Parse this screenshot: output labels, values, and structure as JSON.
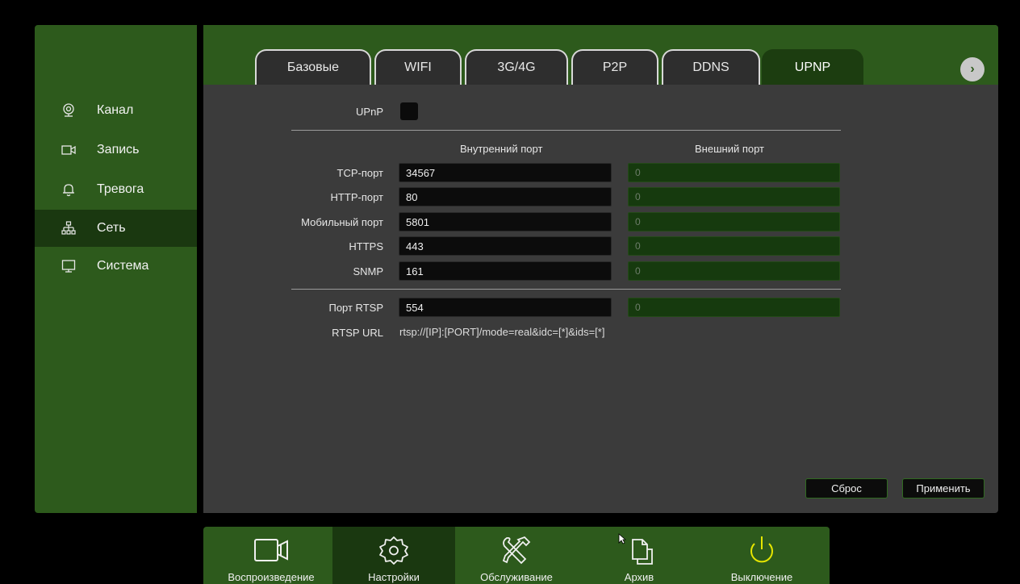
{
  "sidebar": {
    "items": [
      {
        "label": "Канал",
        "icon": "camera-icon"
      },
      {
        "label": "Запись",
        "icon": "video-icon"
      },
      {
        "label": "Тревога",
        "icon": "bell-icon"
      },
      {
        "label": "Сеть",
        "icon": "network-icon",
        "active": true
      },
      {
        "label": "Система",
        "icon": "monitor-icon"
      }
    ]
  },
  "tabs": [
    {
      "label": "Базовые"
    },
    {
      "label": "WIFI"
    },
    {
      "label": "3G/4G"
    },
    {
      "label": "P2P"
    },
    {
      "label": "DDNS"
    },
    {
      "label": "UPNP",
      "active": true
    }
  ],
  "next_icon": "chevron-right-icon",
  "form": {
    "upnp_label": "UPnP",
    "upnp_checked": false,
    "internal_header": "Внутренний порт",
    "external_header": "Внешний порт",
    "rows": [
      {
        "label": "TCP-порт",
        "internal": "34567",
        "external": "0"
      },
      {
        "label": "HTTP-порт",
        "internal": "80",
        "external": "0"
      },
      {
        "label": "Мобильный порт",
        "internal": "5801",
        "external": "0"
      },
      {
        "label": "HTTPS",
        "internal": "443",
        "external": "0"
      },
      {
        "label": "SNMP",
        "internal": "161",
        "external": "0"
      }
    ],
    "rtsp": {
      "label": "Порт RTSP",
      "internal": "554",
      "external": "0"
    },
    "rtsp_url_label": "RTSP URL",
    "rtsp_url_value": "rtsp://[IP]:[PORT]/mode=real&idc=[*]&ids=[*]"
  },
  "buttons": {
    "reset": "Сброс",
    "apply": "Применить"
  },
  "bottom_nav": [
    {
      "label": "Воспроизведение",
      "icon": "playback-camera-icon"
    },
    {
      "label": "Настройки",
      "icon": "settings-gear-icon",
      "active": true
    },
    {
      "label": "Обслуживание",
      "icon": "tools-icon"
    },
    {
      "label": "Архив",
      "icon": "archive-files-icon"
    },
    {
      "label": "Выключение",
      "icon": "power-icon"
    }
  ],
  "colors": {
    "accent_green": "#2d5a1c",
    "active_green": "#1a3810",
    "panel_gray": "#3b3b3b",
    "power_yellow": "#e6e600"
  }
}
